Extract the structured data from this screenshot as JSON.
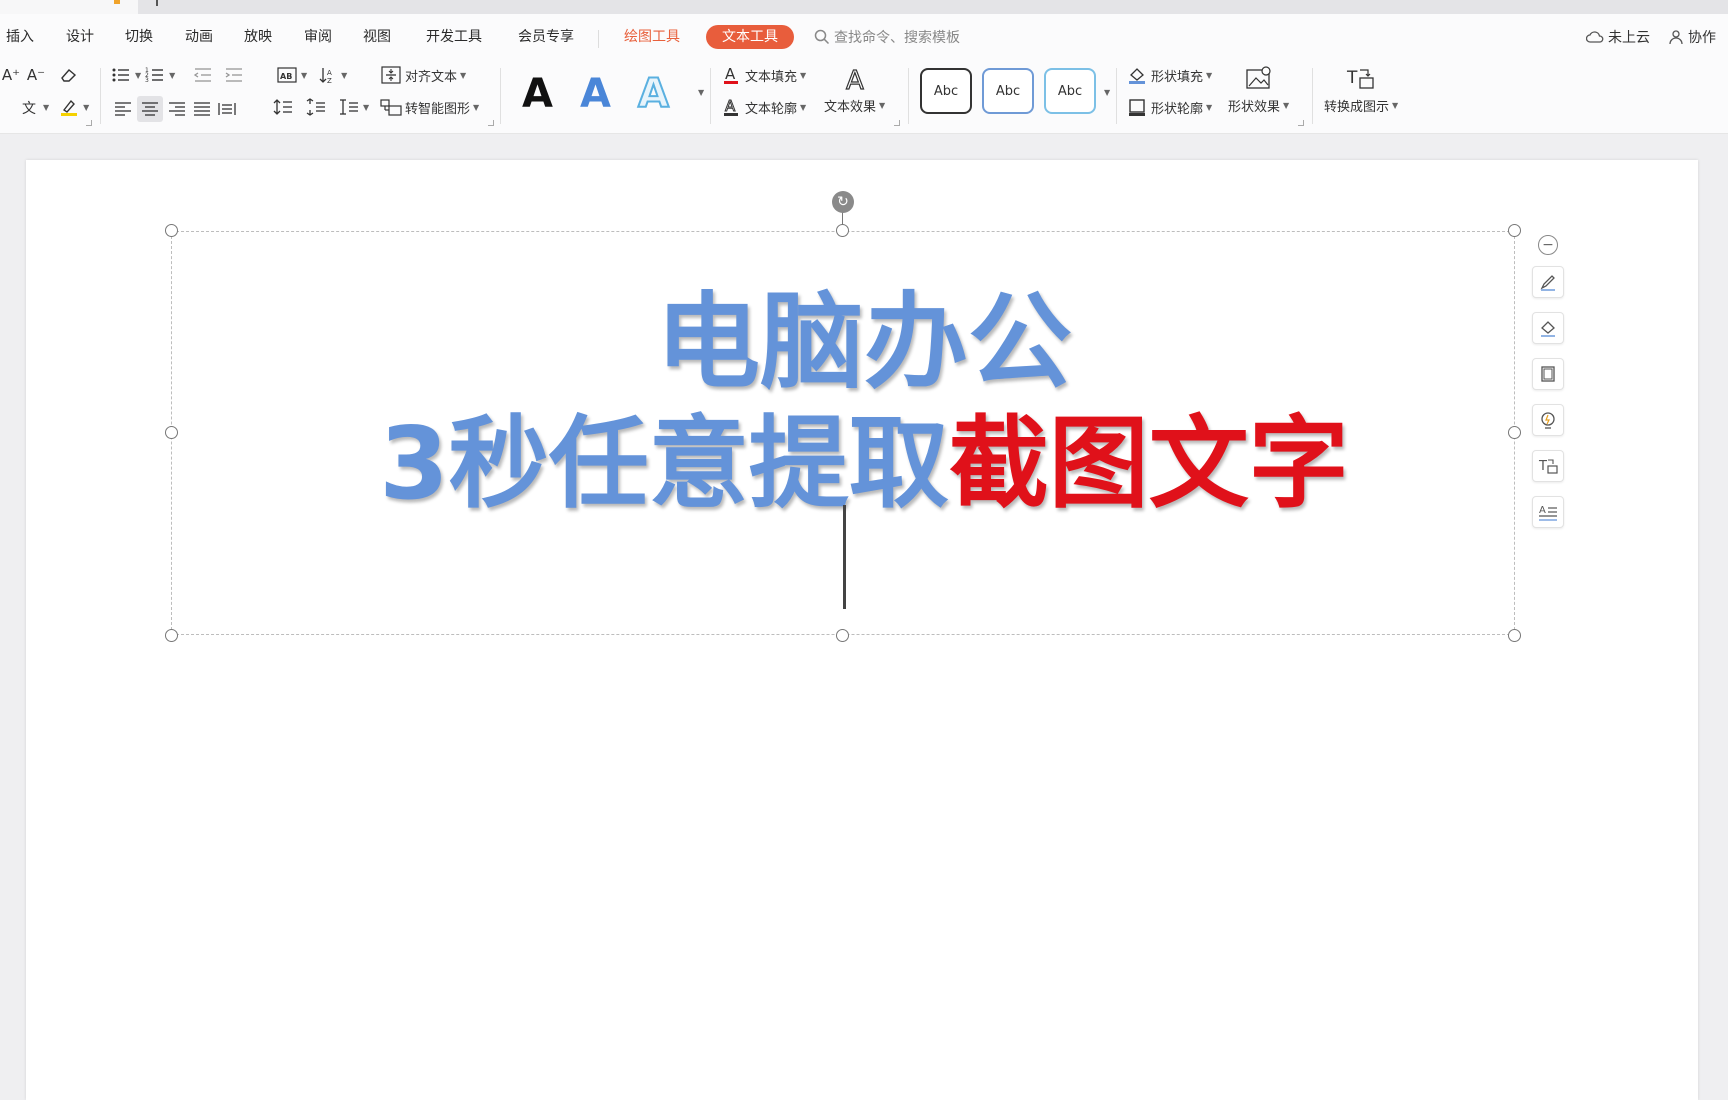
{
  "menu": {
    "items": [
      "插入",
      "设计",
      "切换",
      "动画",
      "放映",
      "审阅",
      "视图",
      "开发工具",
      "会员专享"
    ],
    "drawing_tools": "绘图工具",
    "text_tools": "文本工具",
    "search_placeholder": "查找命令、搜索模板",
    "cloud_status": "未上云",
    "collaborate": "协作"
  },
  "ribbon": {
    "font_grow": "A⁺",
    "font_shrink": "A⁻",
    "align_text": "对齐文本",
    "smart_shape": "转智能图形",
    "text_fill": "文本填充",
    "text_outline": "文本轮廓",
    "text_effects": "文本效果",
    "style_letter": "A",
    "shape_style_label": "Abc",
    "shape_fill": "形状填充",
    "shape_outline": "形状轮廓",
    "shape_effects": "形状效果",
    "convert_diagram": "转换成图示"
  },
  "slide": {
    "line1": "电脑办公",
    "line2_blue": "3秒任意提取",
    "line2_red": "截图文字"
  },
  "colors": {
    "accent": "#e85d3c",
    "title_blue": "#6493d9",
    "title_red": "#e0111a"
  }
}
